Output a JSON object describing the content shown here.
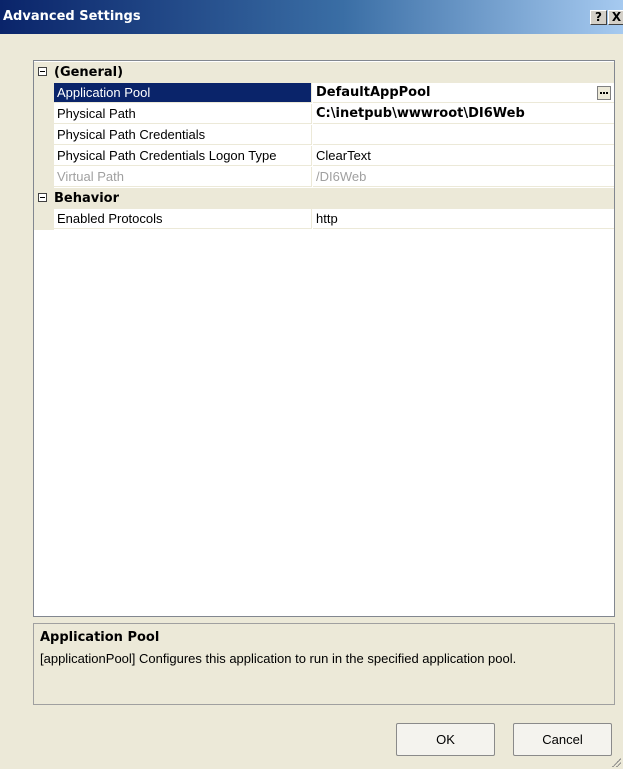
{
  "window": {
    "title": "Advanced Settings",
    "help_button": "?",
    "close_button": "X"
  },
  "categories": [
    {
      "label": "(General)",
      "properties": [
        {
          "name": "Application Pool",
          "value": "DefaultAppPool"
        },
        {
          "name": "Physical Path",
          "value": "C:\\inetpub\\wwwroot\\DI6Web"
        },
        {
          "name": "Physical Path Credentials",
          "value": ""
        },
        {
          "name": "Physical Path Credentials Logon Type",
          "value": "ClearText"
        },
        {
          "name": "Virtual Path",
          "value": "/DI6Web"
        }
      ]
    },
    {
      "label": "Behavior",
      "properties": [
        {
          "name": "Enabled Protocols",
          "value": "http"
        }
      ]
    }
  ],
  "description": {
    "title": "Application Pool",
    "text": "[applicationPool] Configures this application to run in the specified application pool."
  },
  "buttons": {
    "ok": "OK",
    "cancel": "Cancel"
  },
  "colors": {
    "selection": "#0a246a",
    "dialog_bg": "#ece9d8",
    "disabled_text": "#a0a0a0"
  }
}
